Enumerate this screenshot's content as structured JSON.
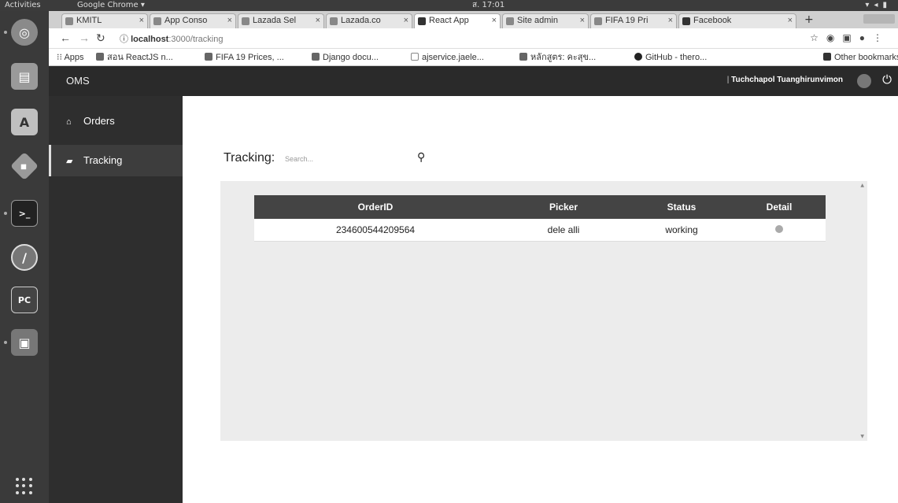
{
  "topbar": {
    "activities": "Activities",
    "app_name": "Google Chrome ▾",
    "clock": "ส. 17:01"
  },
  "dock": {
    "apps": [
      {
        "icon": "chrome-icon"
      },
      {
        "icon": "files-icon"
      },
      {
        "icon": "software-center-icon"
      },
      {
        "icon": "git-icon"
      },
      {
        "icon": "terminal-icon"
      },
      {
        "icon": "postman-icon"
      },
      {
        "icon": "pycharm-icon"
      },
      {
        "icon": "save-icon"
      }
    ]
  },
  "browser": {
    "tabs": [
      {
        "label": "KMITL"
      },
      {
        "label": "App Conso"
      },
      {
        "label": "Lazada Sel"
      },
      {
        "label": "Lazada.co"
      },
      {
        "label": "React App",
        "active": true
      },
      {
        "label": "Site admin"
      },
      {
        "label": "FIFA 19 Pri"
      },
      {
        "label": "Facebook"
      }
    ],
    "url_host": "localhost",
    "url_path": ":3000/tracking",
    "bookmarks": [
      {
        "label": "Apps"
      },
      {
        "label": "สอน ReactJS n..."
      },
      {
        "label": "FIFA 19 Prices, ..."
      },
      {
        "label": "Django docu..."
      },
      {
        "label": "ajservice.jaele..."
      },
      {
        "label": "หลักสูตร: คะสุข..."
      },
      {
        "label": "GitHub - thero..."
      },
      {
        "label": "Other bookmarks"
      }
    ]
  },
  "app": {
    "brand": "OMS",
    "user_name": "Tuchchapol Tuanghirunvimon",
    "sidebar": [
      {
        "label": "Orders",
        "icon": "home-icon"
      },
      {
        "label": "Tracking",
        "icon": "truck-icon",
        "active": true
      }
    ],
    "tracking_label": "Tracking:",
    "search_placeholder": "Search...",
    "table": {
      "headers": [
        "OrderID",
        "Picker",
        "Status",
        "Detail"
      ],
      "rows": [
        {
          "order_id": "234600544209564",
          "picker": "dele alli",
          "status": "working"
        }
      ]
    }
  }
}
